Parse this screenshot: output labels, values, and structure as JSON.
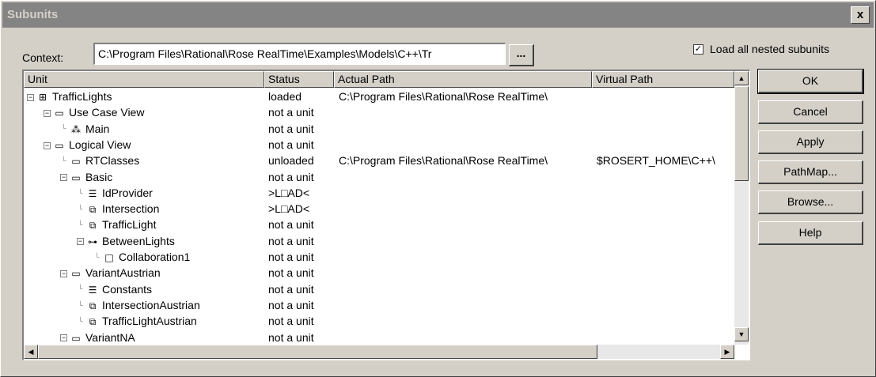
{
  "window": {
    "title": "Subunits",
    "close_label": "x"
  },
  "context": {
    "label": "Context:",
    "value": "C:\\Program Files\\Rational\\Rose RealTime\\Examples\\Models\\C++\\Tr",
    "browse_label": "..."
  },
  "load_nested": {
    "label": "Load all nested subunits",
    "checked": true,
    "check_mark": "✓"
  },
  "columns": [
    "Unit",
    "Status",
    "Actual Path",
    "Virtual Path"
  ],
  "rows": [
    {
      "unit": "TrafficLights",
      "status": "loaded",
      "actual_path": "C:\\Program Files\\Rational\\Rose RealTime\\",
      "virtual_path": "",
      "icon": "model-icon"
    },
    {
      "unit": "Use Case View",
      "status": "not a unit",
      "actual_path": "",
      "virtual_path": "",
      "icon": "folder-icon"
    },
    {
      "unit": "Main",
      "status": "not a unit",
      "actual_path": "",
      "virtual_path": "",
      "icon": "usecase-diagram-icon"
    },
    {
      "unit": "Logical View",
      "status": "not a unit",
      "actual_path": "",
      "virtual_path": "",
      "icon": "folder-icon"
    },
    {
      "unit": "RTClasses",
      "status": "unloaded",
      "actual_path": "C:\\Program Files\\Rational\\Rose RealTime\\",
      "virtual_path": "$ROSERT_HOME\\C++\\",
      "icon": "folder-icon"
    },
    {
      "unit": "Basic",
      "status": "not a unit",
      "actual_path": "",
      "virtual_path": "",
      "icon": "folder-icon"
    },
    {
      "unit": "IdProvider",
      "status": ">L□AD<",
      "actual_path": "",
      "virtual_path": "",
      "icon": "class-icon"
    },
    {
      "unit": "Intersection",
      "status": ">L□AD<",
      "actual_path": "",
      "virtual_path": "",
      "icon": "capsule-icon"
    },
    {
      "unit": "TrafficLight",
      "status": "not a unit",
      "actual_path": "",
      "virtual_path": "",
      "icon": "capsule-icon"
    },
    {
      "unit": "BetweenLights",
      "status": "not a unit",
      "actual_path": "",
      "virtual_path": "",
      "icon": "protocol-icon"
    },
    {
      "unit": "Collaboration1",
      "status": "not a unit",
      "actual_path": "",
      "virtual_path": "",
      "icon": "collaboration-icon"
    },
    {
      "unit": "VariantAustrian",
      "status": "not a unit",
      "actual_path": "",
      "virtual_path": "",
      "icon": "folder-icon"
    },
    {
      "unit": "Constants",
      "status": "not a unit",
      "actual_path": "",
      "virtual_path": "",
      "icon": "class-icon"
    },
    {
      "unit": "IntersectionAustrian",
      "status": "not a unit",
      "actual_path": "",
      "virtual_path": "",
      "icon": "capsule-icon"
    },
    {
      "unit": "TrafficLightAustrian",
      "status": "not a unit",
      "actual_path": "",
      "virtual_path": "",
      "icon": "capsule-icon"
    },
    {
      "unit": "VariantNA",
      "status": "not a unit",
      "actual_path": "",
      "virtual_path": "",
      "icon": "folder-icon"
    }
  ],
  "buttons": {
    "ok": "OK",
    "cancel": "Cancel",
    "apply": "Apply",
    "pathmap": "PathMap...",
    "browse": "Browse...",
    "help": "Help"
  },
  "scroll_glyphs": {
    "up": "▲",
    "down": "▼",
    "left": "◀",
    "right": "▶"
  }
}
